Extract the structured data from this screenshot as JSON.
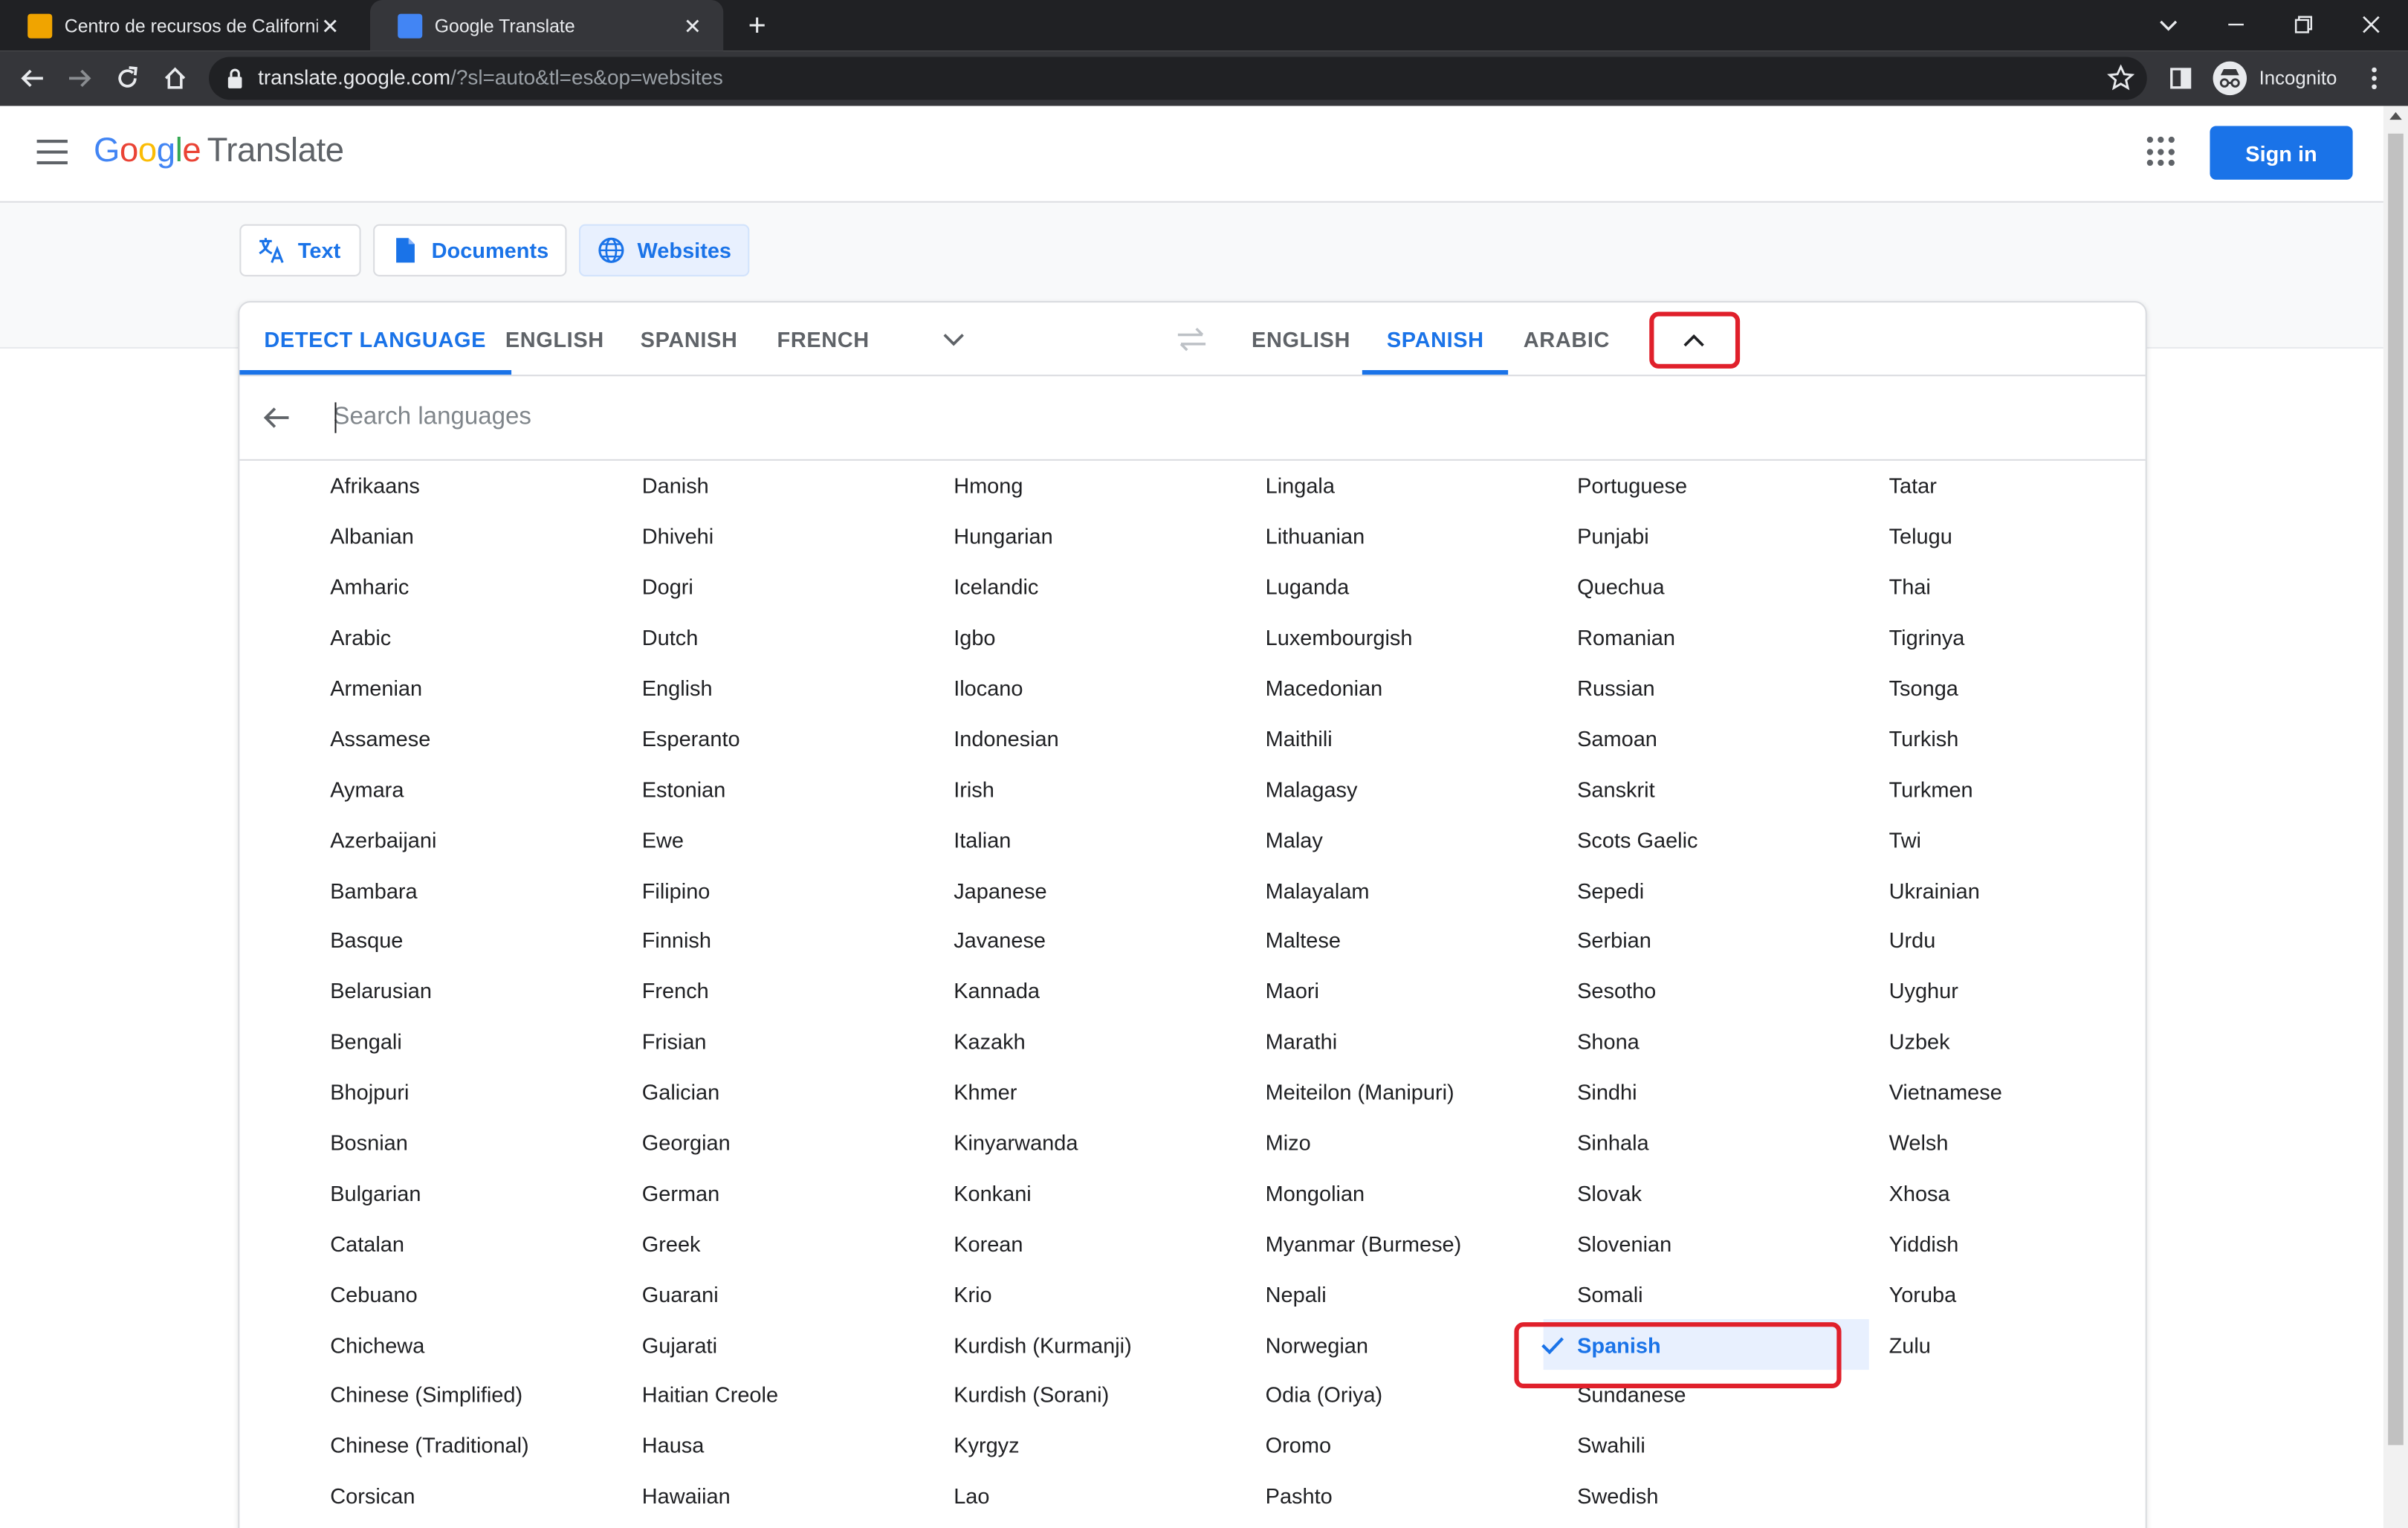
{
  "browser": {
    "tabs": [
      {
        "title": "Centro de recursos de California",
        "active": false
      },
      {
        "title": "Google Translate",
        "active": true
      }
    ],
    "url_host": "translate.google.com",
    "url_rest": "/?sl=auto&tl=es&op=websites",
    "profile_label": "Incognito"
  },
  "header": {
    "logo_letters": [
      "G",
      "o",
      "o",
      "g",
      "l",
      "e"
    ],
    "product": "Translate",
    "signin_label": "Sign in"
  },
  "modes": [
    {
      "label": "Text",
      "icon": "translate-icon",
      "selected": false
    },
    {
      "label": "Documents",
      "icon": "document-icon",
      "selected": false
    },
    {
      "label": "Websites",
      "icon": "globe-icon",
      "selected": true
    }
  ],
  "source_langs": [
    {
      "label": "DETECT LANGUAGE",
      "active": true
    },
    {
      "label": "ENGLISH",
      "active": false
    },
    {
      "label": "SPANISH",
      "active": false
    },
    {
      "label": "FRENCH",
      "active": false
    }
  ],
  "target_langs": [
    {
      "label": "ENGLISH",
      "active": false
    },
    {
      "label": "SPANISH",
      "active": true
    },
    {
      "label": "ARABIC",
      "active": false
    }
  ],
  "search": {
    "placeholder": "Search languages"
  },
  "selected_language": "Spanish",
  "columns": [
    [
      "Afrikaans",
      "Albanian",
      "Amharic",
      "Arabic",
      "Armenian",
      "Assamese",
      "Aymara",
      "Azerbaijani",
      "Bambara",
      "Basque",
      "Belarusian",
      "Bengali",
      "Bhojpuri",
      "Bosnian",
      "Bulgarian",
      "Catalan",
      "Cebuano",
      "Chichewa",
      "Chinese (Simplified)",
      "Chinese (Traditional)",
      "Corsican"
    ],
    [
      "Danish",
      "Dhivehi",
      "Dogri",
      "Dutch",
      "English",
      "Esperanto",
      "Estonian",
      "Ewe",
      "Filipino",
      "Finnish",
      "French",
      "Frisian",
      "Galician",
      "Georgian",
      "German",
      "Greek",
      "Guarani",
      "Gujarati",
      "Haitian Creole",
      "Hausa",
      "Hawaiian"
    ],
    [
      "Hmong",
      "Hungarian",
      "Icelandic",
      "Igbo",
      "Ilocano",
      "Indonesian",
      "Irish",
      "Italian",
      "Japanese",
      "Javanese",
      "Kannada",
      "Kazakh",
      "Khmer",
      "Kinyarwanda",
      "Konkani",
      "Korean",
      "Krio",
      "Kurdish (Kurmanji)",
      "Kurdish (Sorani)",
      "Kyrgyz",
      "Lao"
    ],
    [
      "Lingala",
      "Lithuanian",
      "Luganda",
      "Luxembourgish",
      "Macedonian",
      "Maithili",
      "Malagasy",
      "Malay",
      "Malayalam",
      "Maltese",
      "Maori",
      "Marathi",
      "Meiteilon (Manipuri)",
      "Mizo",
      "Mongolian",
      "Myanmar (Burmese)",
      "Nepali",
      "Norwegian",
      "Odia (Oriya)",
      "Oromo",
      "Pashto"
    ],
    [
      "Portuguese",
      "Punjabi",
      "Quechua",
      "Romanian",
      "Russian",
      "Samoan",
      "Sanskrit",
      "Scots Gaelic",
      "Sepedi",
      "Serbian",
      "Sesotho",
      "Shona",
      "Sindhi",
      "Sinhala",
      "Slovak",
      "Slovenian",
      "Somali",
      "Spanish",
      "Sundanese",
      "Swahili",
      "Swedish"
    ],
    [
      "Tatar",
      "Telugu",
      "Thai",
      "Tigrinya",
      "Tsonga",
      "Turkish",
      "Turkmen",
      "Twi",
      "Ukrainian",
      "Urdu",
      "Uyghur",
      "Uzbek",
      "Vietnamese",
      "Welsh",
      "Xhosa",
      "Yiddish",
      "Yoruba",
      "Zulu"
    ]
  ],
  "colors": {
    "accent": "#1a73e8",
    "highlight_box": "#e0202b",
    "selected_bg": "#e8f0fe"
  }
}
